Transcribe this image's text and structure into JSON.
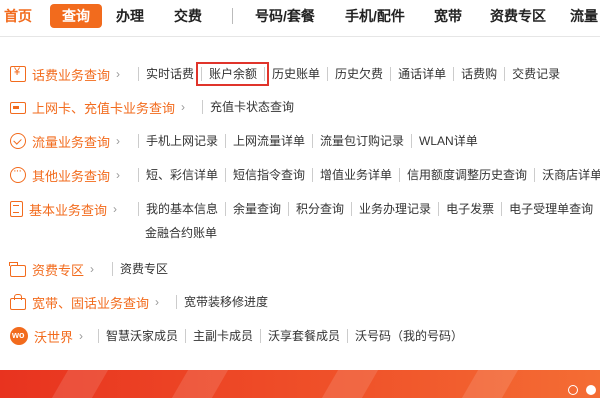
{
  "nav": {
    "items": [
      "首页",
      "查询",
      "办理",
      "交费",
      "号码/套餐",
      "手机/配件",
      "宽带",
      "资费专区",
      "流量"
    ]
  },
  "menu": {
    "rows": [
      {
        "category": "话费业务查询",
        "icon": "bill-icon",
        "links": [
          "实时话费",
          "账户余额",
          "历史账单",
          "历史欠费",
          "通话详单",
          "话费购",
          "交费记录"
        ]
      },
      {
        "category": "上网卡、充值卡业务查询",
        "icon": "card-icon",
        "links": [
          "充值卡状态查询"
        ]
      },
      {
        "category": "流量业务查询",
        "icon": "flow-icon",
        "links": [
          "手机上网记录",
          "上网流量详单",
          "流量包订购记录",
          "WLAN详单"
        ]
      },
      {
        "category": "其他业务查询",
        "icon": "more-icon",
        "links": [
          "短、彩信详单",
          "短信指令查询",
          "增值业务详单",
          "信用额度调整历史查询",
          "沃商店详单"
        ]
      },
      {
        "category": "基本业务查询",
        "icon": "document-icon",
        "links": [
          "我的基本信息",
          "余量查询",
          "积分查询",
          "业务办理记录",
          "电子发票",
          "电子受理单查询"
        ],
        "links2": [
          "金融合约账单"
        ]
      },
      {
        "category": "资费专区",
        "icon": "folder-icon",
        "links": [
          "资费专区"
        ]
      },
      {
        "category": "宽带、固话业务查询",
        "icon": "broadband-icon",
        "links": [
          "宽带装移修进度"
        ]
      },
      {
        "category": "沃世界",
        "icon": "wo-icon",
        "links": [
          "智慧沃家成员",
          "主副卡成员",
          "沃享套餐成员",
          "沃号码（我的号码）"
        ]
      }
    ],
    "highlighted": "账户余额"
  },
  "colors": {
    "accent": "#f26b1d",
    "highlight_border": "#e0342b"
  }
}
